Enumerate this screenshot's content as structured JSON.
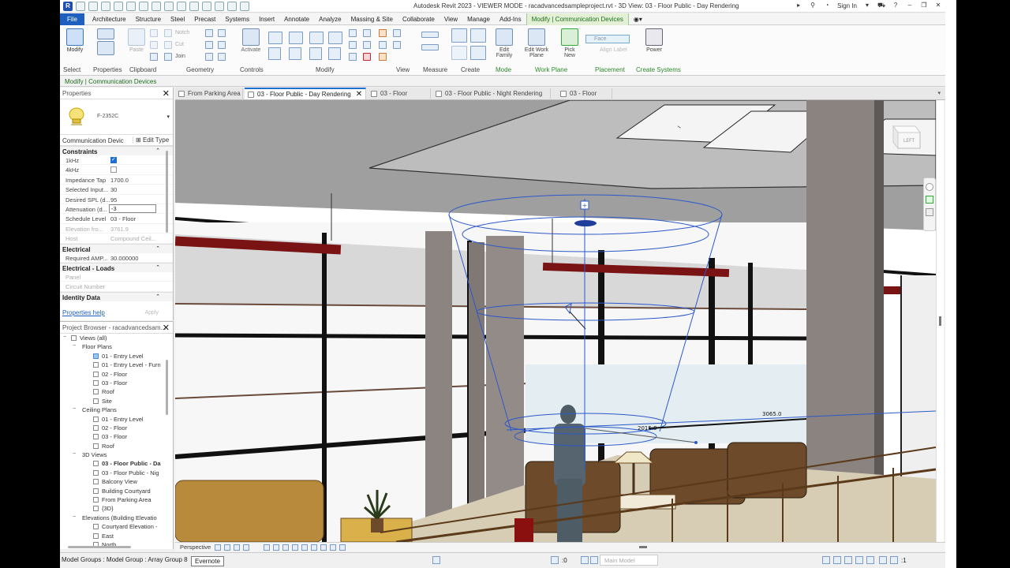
{
  "titlebar": {
    "title": "Autodesk Revit 2023 - VIEWER MODE - racadvancedsampleproject.rvt - 3D View: 03 - Floor Public - Day Rendering",
    "sign_in": "Sign In"
  },
  "menu": {
    "file": "File",
    "tabs": [
      "Architecture",
      "Structure",
      "Steel",
      "Precast",
      "Systems",
      "Insert",
      "Annotate",
      "Analyze",
      "Massing & Site",
      "Collaborate",
      "View",
      "Manage",
      "Add-Ins"
    ],
    "context_tab": "Modify | Communication Devices"
  },
  "ribbon": {
    "modify": "Modify",
    "paste": "Paste",
    "activate": "Activate",
    "edit_family": "Edit Family",
    "edit_work_plane": "Edit Work Plane",
    "pick_new": "Pick New",
    "power": "Power",
    "face_field": "Face",
    "align_label": "Align Label",
    "join": "Join",
    "cut": "Cut",
    "notch": "Notch",
    "panels": {
      "select": "Select",
      "properties": "Properties",
      "clipboard": "Clipboard",
      "geometry": "Geometry",
      "controls": "Controls",
      "modify": "Modify",
      "view": "View",
      "measure": "Measure",
      "create": "Create",
      "mode": "Mode",
      "work_plane": "Work Plane",
      "placement": "Placement",
      "create_systems": "Create Systems"
    }
  },
  "context_label": "Modify | Communication Devices",
  "properties": {
    "title": "Properties",
    "type_name": "F-2352C",
    "instance_filter": "Communication Devic",
    "edit_type": "Edit Type",
    "sections": {
      "constraints": "Constraints",
      "electrical": "Electrical",
      "electrical_loads": "Electrical - Loads",
      "identity": "Identity Data"
    },
    "rows": {
      "f1": {
        "name": "1kHz"
      },
      "f2": {
        "name": "4kHz"
      },
      "impedance": {
        "name": "Impedance Tap",
        "value": "1700.0"
      },
      "selected_input": {
        "name": "Selected Input...",
        "value": "30"
      },
      "desired_spl": {
        "name": "Desired SPL (d...",
        "value": "95"
      },
      "attenuation": {
        "name": "Attenuation (d...",
        "value": "-3"
      },
      "schedule_level": {
        "name": "Schedule Level",
        "value": "03 - Floor"
      },
      "elevation": {
        "name": "Elevation fro...",
        "value": "3761.9"
      },
      "host": {
        "name": "Host",
        "value": "Compound Ceil..."
      },
      "required_amp": {
        "name": "Required AMP...",
        "value": "30.000000"
      },
      "panel": {
        "name": "Panel"
      },
      "circuit": {
        "name": "Circuit Number"
      }
    },
    "help": "Properties help",
    "apply": "Apply"
  },
  "browser": {
    "title": "Project Browser - racadvancedsam...",
    "items": [
      {
        "label": "Views (all)",
        "level": 0,
        "type": "root"
      },
      {
        "label": "Floor Plans",
        "level": 1,
        "type": "group"
      },
      {
        "label": "01 - Entry Level",
        "level": 2,
        "type": "view",
        "sel": true
      },
      {
        "label": "01 - Entry Level - Furn",
        "level": 2,
        "type": "view"
      },
      {
        "label": "02 - Floor",
        "level": 2,
        "type": "view"
      },
      {
        "label": "03 - Floor",
        "level": 2,
        "type": "view"
      },
      {
        "label": "Roof",
        "level": 2,
        "type": "view"
      },
      {
        "label": "Site",
        "level": 2,
        "type": "view"
      },
      {
        "label": "Ceiling Plans",
        "level": 1,
        "type": "group"
      },
      {
        "label": "01 - Entry Level",
        "level": 2,
        "type": "view"
      },
      {
        "label": "02 - Floor",
        "level": 2,
        "type": "view"
      },
      {
        "label": "03 - Floor",
        "level": 2,
        "type": "view"
      },
      {
        "label": "Roof",
        "level": 2,
        "type": "view"
      },
      {
        "label": "3D Views",
        "level": 1,
        "type": "group"
      },
      {
        "label": "03 - Floor Public - Da",
        "level": 2,
        "type": "view",
        "bold": true
      },
      {
        "label": "03 - Floor Public - Nig",
        "level": 2,
        "type": "view"
      },
      {
        "label": "Balcony View",
        "level": 2,
        "type": "view"
      },
      {
        "label": "Building Courtyard",
        "level": 2,
        "type": "view"
      },
      {
        "label": "From Parking Area",
        "level": 2,
        "type": "view"
      },
      {
        "label": "{3D}",
        "level": 2,
        "type": "view"
      },
      {
        "label": "Elevations (Building Elevatio",
        "level": 1,
        "type": "group"
      },
      {
        "label": "Courtyard Elevation -",
        "level": 2,
        "type": "view"
      },
      {
        "label": "East",
        "level": 2,
        "type": "view"
      },
      {
        "label": "North",
        "level": 2,
        "type": "view"
      }
    ]
  },
  "view_tabs": [
    {
      "label": "From Parking Area",
      "active": false
    },
    {
      "label": "03 - Floor Public - Day Rendering",
      "active": true
    },
    {
      "label": "03 - Floor",
      "active": false
    },
    {
      "label": "03 - Floor Public - Night Rendering",
      "active": false
    },
    {
      "label": "03 - Floor",
      "active": false
    }
  ],
  "viewport": {
    "dim1": "3065.0",
    "dim2": "2015.0",
    "viewcube": "LEFT"
  },
  "view_control": {
    "mode": "Perspective"
  },
  "status": {
    "text": "Model Groups : Model Group : Array Group 8",
    "tooltip": "Evernote",
    "zero": ":0",
    "model": "Main Model",
    "filter": ":1"
  }
}
